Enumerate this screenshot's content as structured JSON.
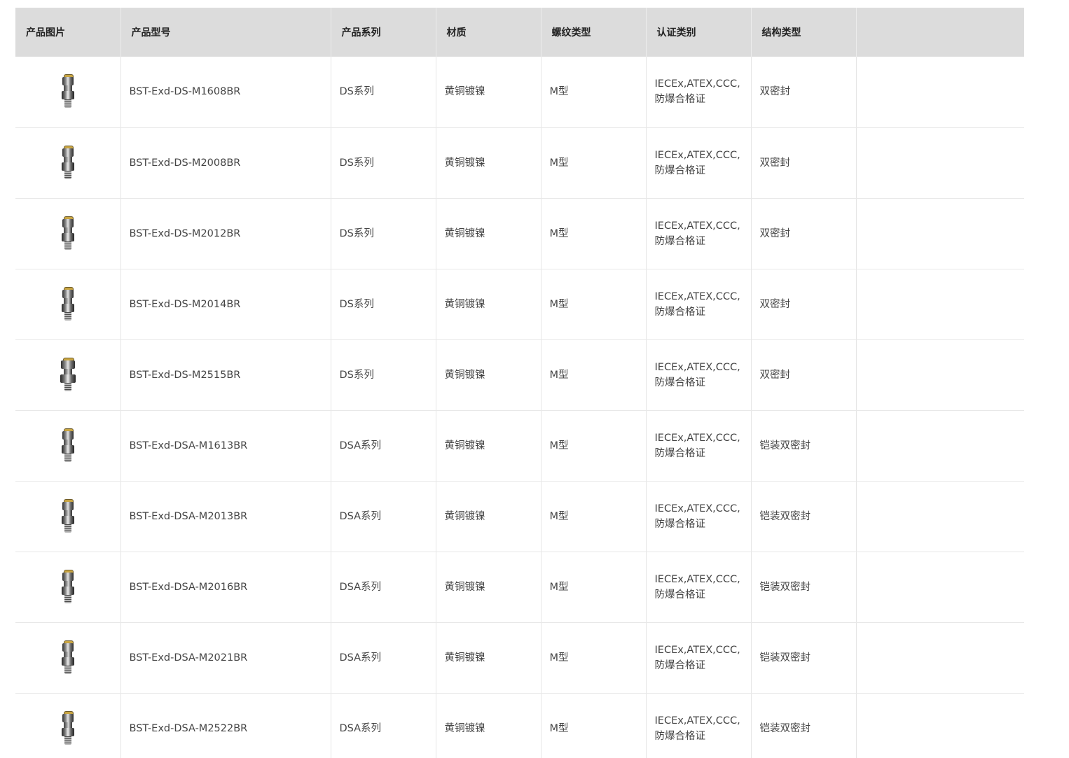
{
  "table": {
    "headers": [
      "产品图片",
      "产品型号",
      "产品系列",
      "材质",
      "螺纹类型",
      "认证类别",
      "结构类型",
      ""
    ],
    "rows": [
      {
        "image_icon": "cable-gland-icon",
        "model": "BST-Exd-DS-M1608BR",
        "series": "DS系列",
        "material": "黄铜镀镍",
        "thread": "M型",
        "cert": "IECEx,ATEX,CCC,防爆合格证",
        "structure": "双密封",
        "extra": ""
      },
      {
        "image_icon": "cable-gland-icon",
        "model": "BST-Exd-DS-M2008BR",
        "series": "DS系列",
        "material": "黄铜镀镍",
        "thread": "M型",
        "cert": "IECEx,ATEX,CCC,防爆合格证",
        "structure": "双密封",
        "extra": ""
      },
      {
        "image_icon": "cable-gland-icon",
        "model": "BST-Exd-DS-M2012BR",
        "series": "DS系列",
        "material": "黄铜镀镍",
        "thread": "M型",
        "cert": "IECEx,ATEX,CCC,防爆合格证",
        "structure": "双密封",
        "extra": ""
      },
      {
        "image_icon": "cable-gland-icon",
        "model": "BST-Exd-DS-M2014BR",
        "series": "DS系列",
        "material": "黄铜镀镍",
        "thread": "M型",
        "cert": "IECEx,ATEX,CCC,防爆合格证",
        "structure": "双密封",
        "extra": ""
      },
      {
        "image_icon": "cable-gland-icon",
        "model": "BST-Exd-DS-M2515BR",
        "series": "DS系列",
        "material": "黄铜镀镍",
        "thread": "M型",
        "cert": "IECEx,ATEX,CCC,防爆合格证",
        "structure": "双密封",
        "extra": ""
      },
      {
        "image_icon": "cable-gland-icon",
        "model": "BST-Exd-DSA-M1613BR",
        "series": "DSA系列",
        "material": "黄铜镀镍",
        "thread": "M型",
        "cert": "IECEx,ATEX,CCC,防爆合格证",
        "structure": "铠装双密封",
        "extra": ""
      },
      {
        "image_icon": "cable-gland-icon",
        "model": "BST-Exd-DSA-M2013BR",
        "series": "DSA系列",
        "material": "黄铜镀镍",
        "thread": "M型",
        "cert": "IECEx,ATEX,CCC,防爆合格证",
        "structure": "铠装双密封",
        "extra": ""
      },
      {
        "image_icon": "cable-gland-icon",
        "model": "BST-Exd-DSA-M2016BR",
        "series": "DSA系列",
        "material": "黄铜镀镍",
        "thread": "M型",
        "cert": "IECEx,ATEX,CCC,防爆合格证",
        "structure": "铠装双密封",
        "extra": ""
      },
      {
        "image_icon": "cable-gland-icon",
        "model": "BST-Exd-DSA-M2021BR",
        "series": "DSA系列",
        "material": "黄铜镀镍",
        "thread": "M型",
        "cert": "IECEx,ATEX,CCC,防爆合格证",
        "structure": "铠装双密封",
        "extra": ""
      },
      {
        "image_icon": "cable-gland-icon",
        "model": "BST-Exd-DSA-M2522BR",
        "series": "DSA系列",
        "material": "黄铜镀镍",
        "thread": "M型",
        "cert": "IECEx,ATEX,CCC,防爆合格证",
        "structure": "铠装双密封",
        "extra": ""
      }
    ]
  },
  "colors": {
    "header_bg": "#dcdcdc",
    "border": "#e6e6e6",
    "text": "#444444"
  }
}
